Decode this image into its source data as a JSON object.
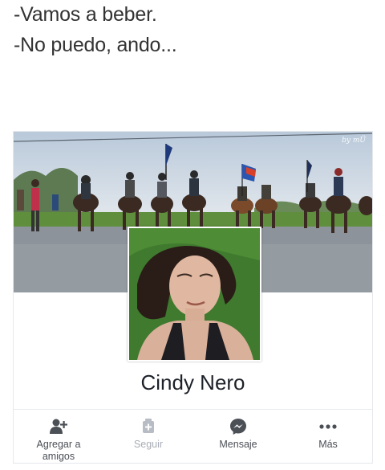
{
  "caption": {
    "line1": "-Vamos a beber.",
    "line2": "-No puedo, ando..."
  },
  "profile": {
    "cover_watermark": "by mÜ",
    "name": "Cindy Nero"
  },
  "actions": [
    {
      "label_line1": "Agregar a",
      "label_line2": "amigos",
      "icon": "add-friend-icon",
      "enabled": true
    },
    {
      "label_line1": "Seguir",
      "label_line2": "",
      "icon": "follow-icon",
      "enabled": false
    },
    {
      "label_line1": "Mensaje",
      "label_line2": "",
      "icon": "messenger-icon",
      "enabled": true
    },
    {
      "label_line1": "Más",
      "label_line2": "",
      "icon": "more-dots-icon",
      "enabled": true
    }
  ],
  "colors": {
    "text": "#1d2129",
    "action_text": "#4b4f56",
    "disabled_text": "#a8adb5",
    "sky": "#c9d6e3",
    "grass": "#3f7a2e"
  }
}
